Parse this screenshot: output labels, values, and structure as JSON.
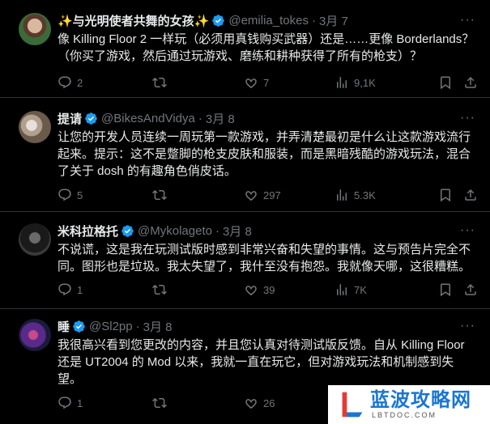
{
  "tweets": [
    {
      "name": "✨与光明使者共舞的女孩✨",
      "handle": "@emilia_tokes",
      "date": "3月 7",
      "text": "像 Killing Floor 2 一样玩（必须用真钱购买武器）还是……更像 Borderlands？（你买了游戏，然后通过玩游戏、磨练和耕种获得了所有的枪支）？",
      "replies": "2",
      "retweets": "",
      "likes": "7",
      "views": "9,1K",
      "avatar_color": "#3a6b3a"
    },
    {
      "name": "提请",
      "handle": "@BikesAndVidya",
      "date": "3月 8",
      "text": "让您的开发人员连续一周玩第一款游戏，并弄清楚最初是什么让这款游戏流行起来。提示：这不是蹩脚的枪支皮肤和服装，而是黑暗残酷的游戏玩法，混合了关于 dosh 的有趣角色俏皮话。",
      "replies": "5",
      "retweets": "",
      "likes": "297",
      "views": "5.3K",
      "avatar_color": "#8a7a6a"
    },
    {
      "name": "米科拉格托",
      "handle": "@Mykolageto",
      "date": "3月 8",
      "text": "不说谎，这是我在玩测试版时感到非常兴奋和失望的事情。这与预告片完全不同。图形也是垃圾。我太失望了，我什至没有抱怨。我就像天哪，这很糟糕。",
      "replies": "1",
      "retweets": "",
      "likes": "39",
      "views": "7K",
      "avatar_color": "#2a2a2a"
    },
    {
      "name": "睡",
      "handle": "@Sl2pp",
      "date": "3月 8",
      "text": "我很高兴看到您更改的内容，并且您认真对待测试版反馈。自从 Killing Floor 还是 UT2004 的 Mod 以来，我就一直在玩它，但对游戏玩法和机制感到失望。",
      "replies": "1",
      "retweets": "",
      "likes": "26",
      "views": "",
      "avatar_color": "#3a1a5a"
    }
  ],
  "colors": {
    "background": "#000000",
    "text": "#e7e9ea",
    "muted": "#71767b",
    "verified": "#1d9bf0",
    "divider": "#2f3336"
  },
  "watermark": {
    "title": "蓝波攻略网",
    "sub": "LBTDOC.COM"
  }
}
